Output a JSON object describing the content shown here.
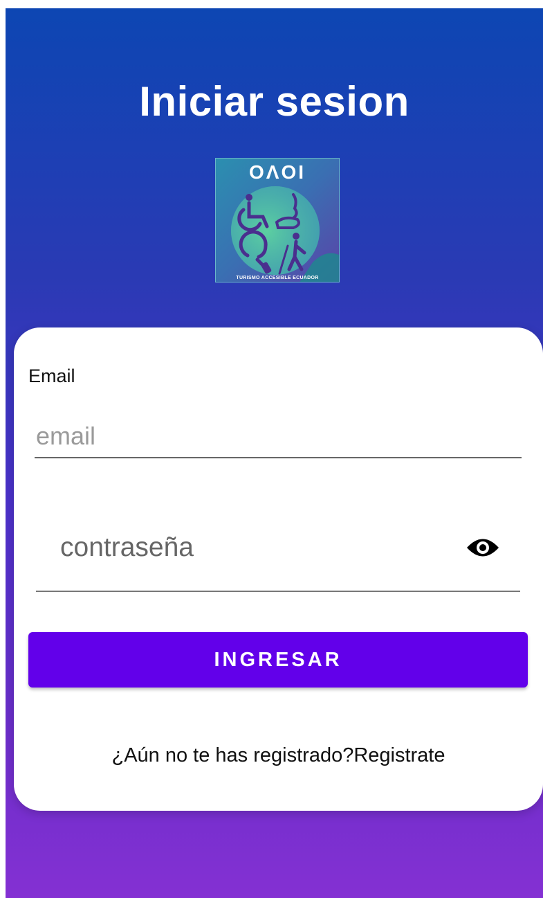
{
  "header": {
    "title": "Iniciar sesion"
  },
  "logo": {
    "word": "ОΛОΙ",
    "subtitle": "TURISMO ACCESIBLE ECUADOR",
    "icons": [
      "wheelchair-icon",
      "sign-language-icon",
      "hearing-icon",
      "blind-person-icon"
    ]
  },
  "form": {
    "email_label": "Email",
    "email_placeholder": "email",
    "email_value": "",
    "password_placeholder": "contraseña",
    "password_value": "",
    "visibility_icon": "eye-icon",
    "submit_label": "INGRESAR",
    "register_text": "¿Aún no te has registrado?Registrate"
  },
  "colors": {
    "gradient_top": "#0d46b3",
    "gradient_bottom": "#8430d3",
    "button": "#6200ea"
  }
}
